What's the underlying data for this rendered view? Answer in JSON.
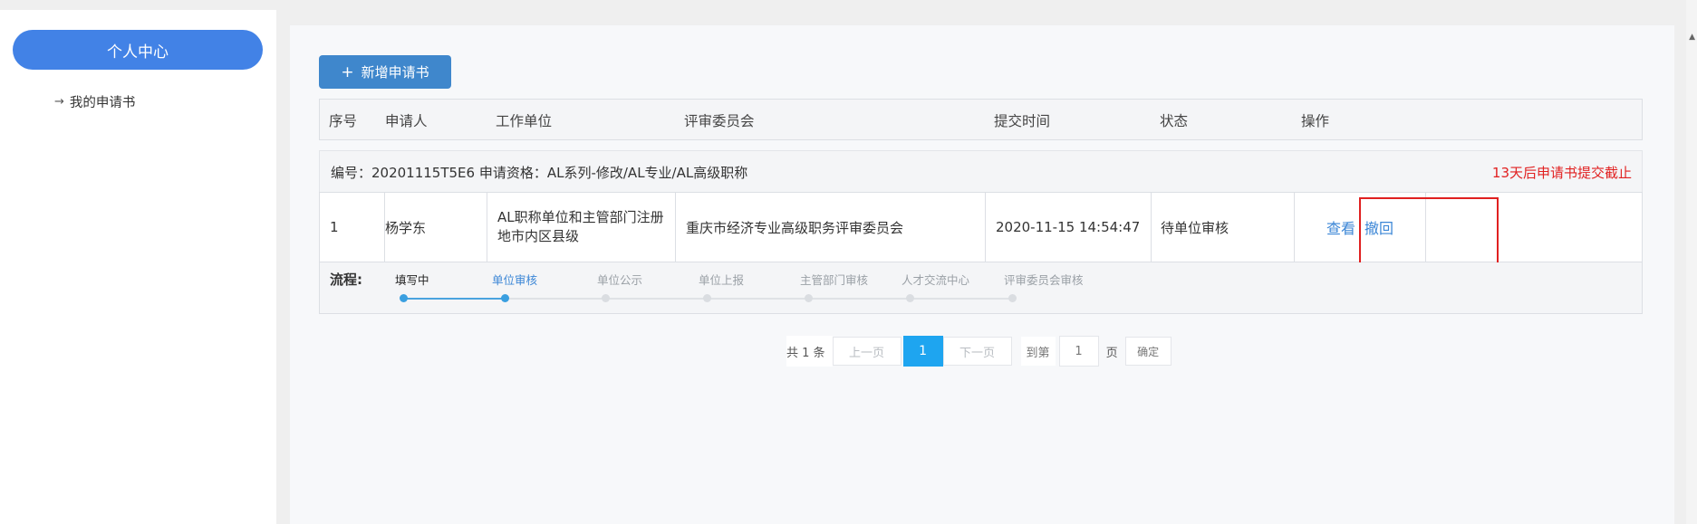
{
  "sidebar": {
    "profile_label": "个人中心",
    "items": [
      {
        "label": "我的申请书"
      }
    ]
  },
  "toolbar": {
    "add_label": "新增申请书"
  },
  "table": {
    "columns": [
      "序号",
      "申请人",
      "工作单位",
      "评审委员会",
      "提交时间",
      "状态",
      "操作"
    ],
    "group": {
      "code": "编号：20201115T5E6 申请资格：AL系列-修改/AL专业/AL高级职称",
      "deadline": "13天后申请书提交截止"
    },
    "rows": [
      {
        "index": "1",
        "applicant": "杨学东",
        "work_unit": "AL职称单位和主管部门注册地市内区县级",
        "committee": "重庆市经济专业高级职务评审委员会",
        "submit_time": "2020-11-15 14:54:47",
        "status": "待单位审核",
        "view_label": "查看",
        "withdraw_label": "撤回"
      }
    ],
    "flow": {
      "label": "流程:",
      "steps": [
        "填写中",
        "单位审核",
        "单位公示",
        "单位上报",
        "主管部门审核",
        "人才交流中心",
        "评审委员会审核"
      ],
      "current_index": 1
    }
  },
  "pager": {
    "total": "共 1 条",
    "prev": "上一页",
    "current_page": "1",
    "next": "下一页",
    "goto": "到第",
    "page_input": "1",
    "unit": "页",
    "confirm": "确定"
  },
  "colors": {
    "primary": "#4282e6",
    "add_button": "#3f87cc",
    "deadline": "#e12121",
    "link": "#3b86d6",
    "highlight": "#e02020",
    "page_active": "#1ea5f0"
  }
}
